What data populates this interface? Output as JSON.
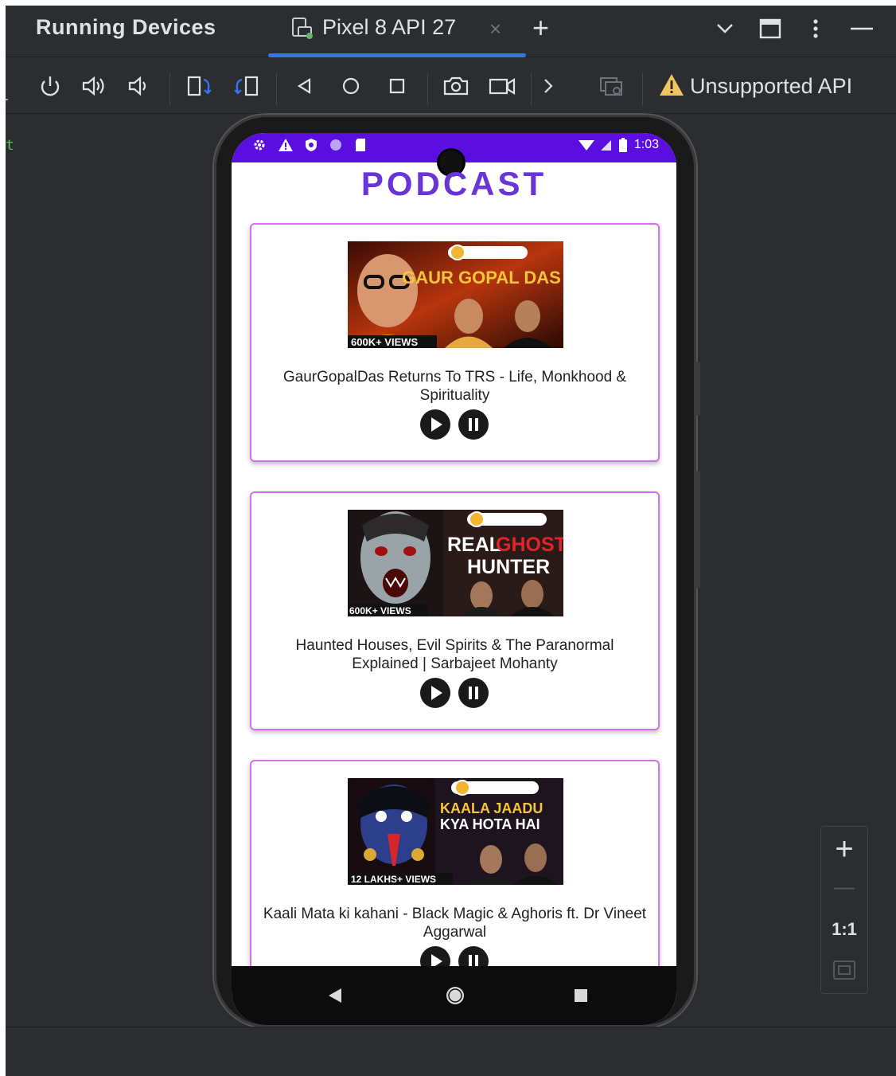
{
  "window": {
    "panel_title": "Running Devices",
    "device_tab_label": "Pixel 8 API 27",
    "close_glyph": "×",
    "add_glyph": "+"
  },
  "toolbar": {
    "icons": [
      "power-icon",
      "volume-up-icon",
      "volume-down-icon",
      "rotate-left-icon",
      "rotate-right-icon",
      "back-icon",
      "home-icon",
      "overview-icon",
      "screenshot-icon",
      "screen-record-icon",
      "more-icon",
      "device-mirror-icon"
    ],
    "warning_label": "Unsupported API"
  },
  "colors": {
    "accent_blue": "#3574f0",
    "status_bar": "#5a0fe0",
    "app_title": "#6a35d6",
    "card_border": "#d66df2",
    "warning": "#f2c55c"
  },
  "phone": {
    "status_time": "1:03",
    "app_title": "PODCAST",
    "cards": [
      {
        "thumb_headline": "GAUR GOPAL DAS",
        "thumb_views": "600K+ VIEWS",
        "title": "GaurGopalDas Returns To TRS - Life, Monkhood & Spirituality"
      },
      {
        "thumb_headline_1": "REAL",
        "thumb_headline_2": "GHOST",
        "thumb_headline_3": "HUNTER",
        "thumb_views": "600K+ VIEWS",
        "title": "Haunted Houses, Evil Spirits & The Paranormal Explained | Sarbajeet Mohanty"
      },
      {
        "thumb_headline_1": "KAALA JAADU",
        "thumb_headline_2": "KYA HOTA HAI",
        "thumb_views": "12 LAKHS+ VIEWS",
        "title": "Kaali Mata ki kahani - Black Magic & Aghoris ft. Dr Vineet Aggarwal"
      }
    ]
  },
  "zoom": {
    "plus": "+",
    "minus": "—",
    "actual_size": "1:1"
  }
}
